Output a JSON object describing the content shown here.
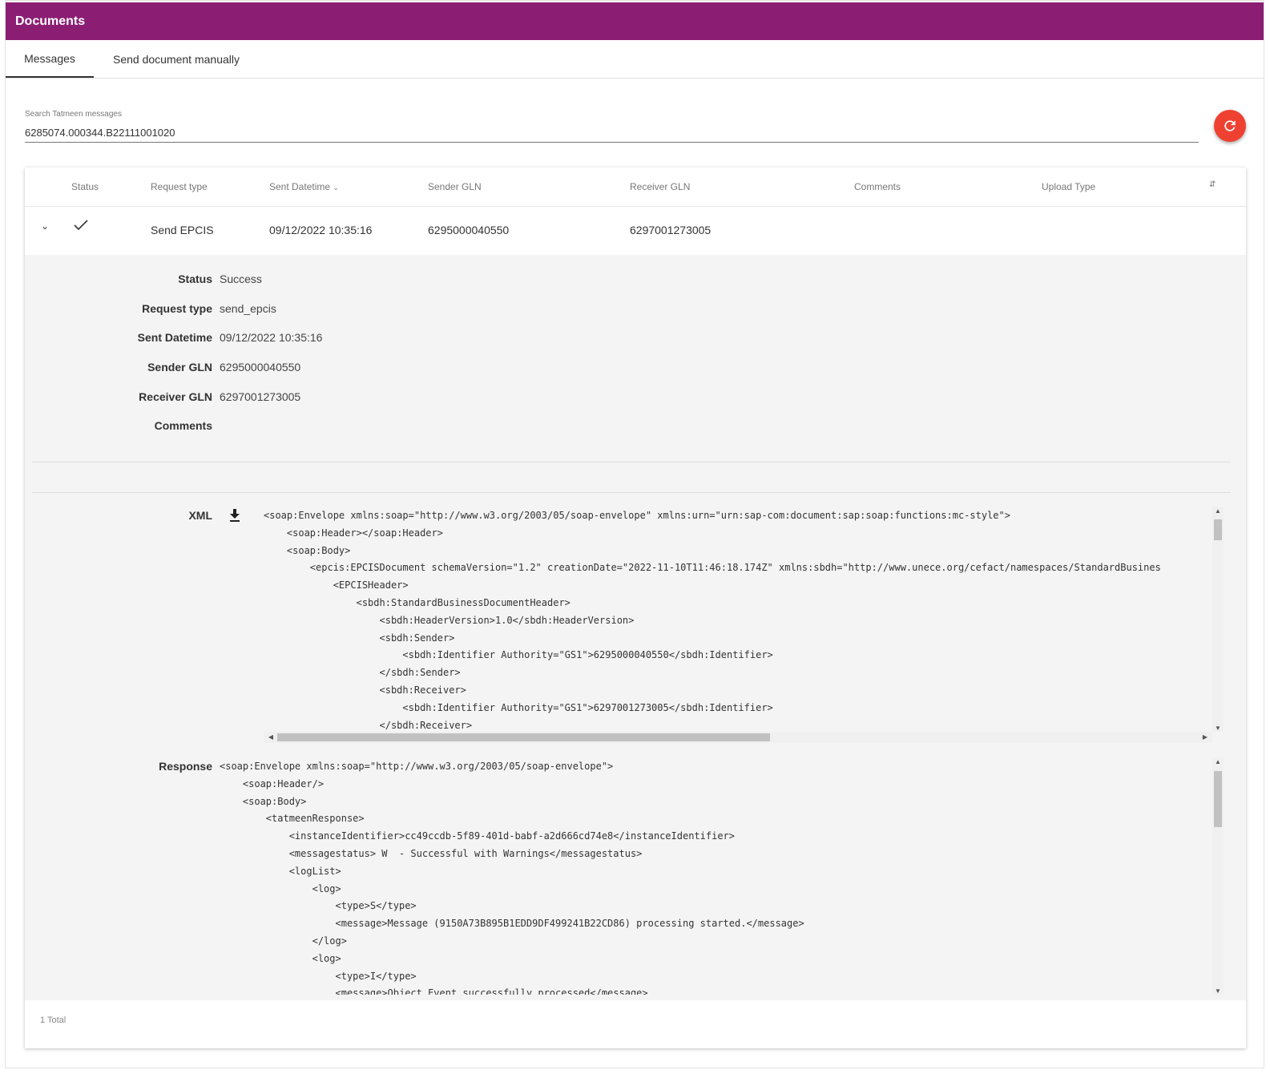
{
  "title": "Documents",
  "tabs": [
    "Messages",
    "Send document manually"
  ],
  "search": {
    "label": "Search Tatmeen messages",
    "value": "6285074.000344.B22111001020"
  },
  "table": {
    "headers": [
      "Status",
      "Request type",
      "Sent Datetime",
      "Sender GLN",
      "Receiver GLN",
      "Comments",
      "Upload Type"
    ],
    "row": {
      "request_type": "Send EPCIS",
      "sent_datetime": "09/12/2022 10:35:16",
      "sender_gln": "6295000040550",
      "receiver_gln": "6297001273005"
    }
  },
  "details": {
    "labels": [
      "Status",
      "Request type",
      "Sent Datetime",
      "Sender GLN",
      "Receiver GLN",
      "Comments"
    ],
    "values": [
      "Success",
      "send_epcis",
      "09/12/2022 10:35:16",
      "6295000040550",
      "6297001273005",
      ""
    ],
    "xml_label": "XML",
    "response_label": "Response",
    "xml_lines": [
      "<soap:Envelope xmlns:soap=\"http://www.w3.org/2003/05/soap-envelope\" xmlns:urn=\"urn:sap-com:document:sap:soap:functions:mc-style\">",
      "    <soap:Header></soap:Header>",
      "    <soap:Body>",
      "        <epcis:EPCISDocument schemaVersion=\"1.2\" creationDate=\"2022-11-10T11:46:18.174Z\" xmlns:sbdh=\"http://www.unece.org/cefact/namespaces/StandardBusines",
      "            <EPCISHeader>",
      "                <sbdh:StandardBusinessDocumentHeader>",
      "                    <sbdh:HeaderVersion>1.0</sbdh:HeaderVersion>",
      "                    <sbdh:Sender>",
      "                        <sbdh:Identifier Authority=\"GS1\">6295000040550</sbdh:Identifier>",
      "                    </sbdh:Sender>",
      "                    <sbdh:Receiver>",
      "                        <sbdh:Identifier Authority=\"GS1\">6297001273005</sbdh:Identifier>",
      "                    </sbdh:Receiver>"
    ],
    "response_lines": [
      "<soap:Envelope xmlns:soap=\"http://www.w3.org/2003/05/soap-envelope\">",
      "    <soap:Header/>",
      "    <soap:Body>",
      "        <tatmeenResponse>",
      "            <instanceIdentifier>cc49ccdb-5f89-401d-babf-a2d666cd74e8</instanceIdentifier>",
      "            <messagestatus> W  - Successful with Warnings</messagestatus>",
      "            <logList>",
      "                <log>",
      "                    <type>S</type>",
      "                    <message>Message (9150A73B895B1EDD9DF499241B22CD86) processing started.</message>",
      "                </log>",
      "                <log>",
      "                    <type>I</type>",
      "                    <message>Object Event successfully processed</message>"
    ]
  },
  "footer": "1 Total",
  "colors": {
    "brand": "#8b1e73",
    "accent": "#ef4131"
  }
}
